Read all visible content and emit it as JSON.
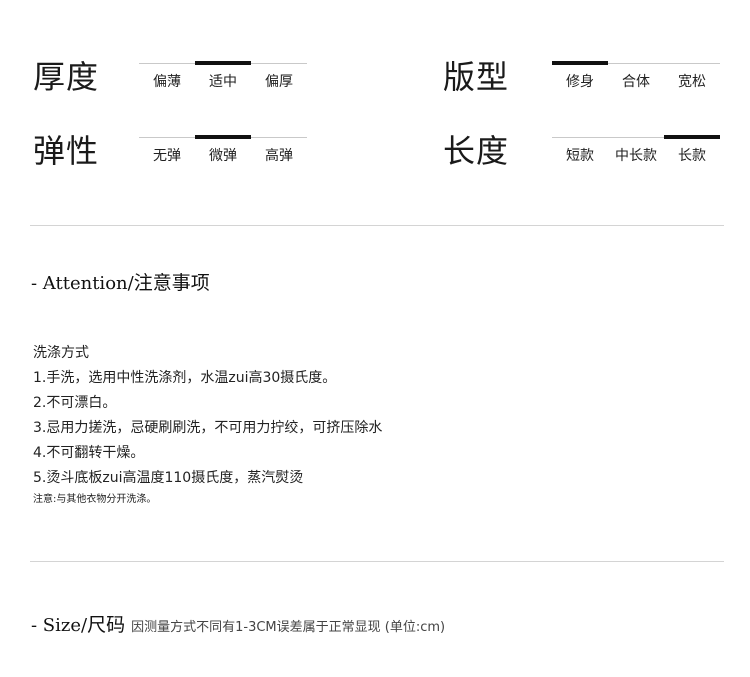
{
  "attributes": {
    "thickness": {
      "label": "厚度",
      "options": [
        "偏薄",
        "适中",
        "偏厚"
      ],
      "selected": 1
    },
    "fit": {
      "label": "版型",
      "options": [
        "修身",
        "合体",
        "宽松"
      ],
      "selected": 0
    },
    "elasticity": {
      "label": "弹性",
      "options": [
        "无弹",
        "微弹",
        "高弹"
      ],
      "selected": 1
    },
    "length": {
      "label": "长度",
      "options": [
        "短款",
        "中长款",
        "长款"
      ],
      "selected": 2
    }
  },
  "attention": {
    "heading": "- Attention/",
    "heading_cjk": "注意事项"
  },
  "care": {
    "title": "洗涤方式",
    "items": [
      "1.手洗，选用中性洗涤剂，水温zui高30摄氏度。",
      "2.不可漂白。",
      "3.忌用力搓洗，忌硬刷刷洗，不可用力拧绞，可挤压除水",
      "4.不可翻转干燥。",
      "5.烫斗底板zui高温度110摄氏度，蒸汽熨烫"
    ],
    "note": "注意:与其他衣物分开洗涤。"
  },
  "size": {
    "heading": "- Size/",
    "heading_cjk": "尺码",
    "note": "因测量方式不同有1-3CM误差属于正常显现 (单位:cm)"
  },
  "colors": {
    "line": "#c9c9c9",
    "marker": "#111111",
    "text": "#222222",
    "divider": "#d4d4d4"
  }
}
